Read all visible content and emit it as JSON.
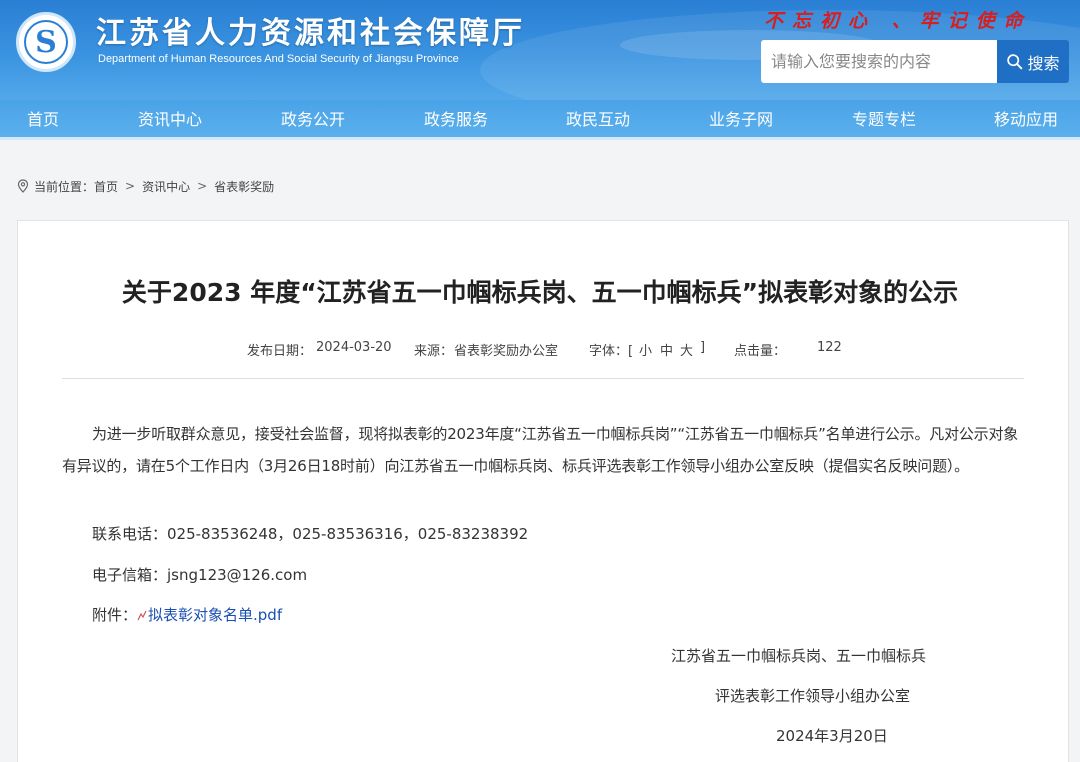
{
  "header": {
    "site_title": "江苏省人力资源和社会保障厅",
    "site_subtitle": "Department of Human Resources And Social Security of Jiangsu Province",
    "slogan": "不忘初心  、牢记使命",
    "search_placeholder": "请输入您要搜索的内容",
    "search_label": "搜索",
    "brand_color": "#2a7fd4",
    "slogan_color": "#d81e1e"
  },
  "nav": {
    "items": [
      "首页",
      "资讯中心",
      "政务公开",
      "政务服务",
      "政民互动",
      "业务子网",
      "专题专栏",
      "移动应用"
    ]
  },
  "breadcrumb": {
    "prefix": "当前位置：",
    "items": [
      "首页",
      "资讯中心",
      "省表彰奖励"
    ],
    "separator": ">"
  },
  "article": {
    "title": "关于2023 年度“江苏省五一巾帼标兵岗、五一巾帼标兵”拟表彰对象的公示",
    "publish_label": "发布日期：",
    "publish_date": "2024-03-20",
    "source_label": "来源：",
    "source": "省表彰奖励办公室",
    "font_label": "字体：[",
    "font_small": "小",
    "font_medium": "中",
    "font_large": "大",
    "font_close": "]",
    "views_label": "点击量：",
    "views": "122",
    "body": "为进一步听取群众意见，接受社会监督，现将拟表彰的2023年度“江苏省五一巾帼标兵岗”“江苏省五一巾帼标兵”名单进行公示。凡对公示对象有异议的，请在5个工作日内（3月26日18时前）向江苏省五一巾帼标兵岗、标兵评选表彰工作领导小组办公室反映（提倡实名反映问题）。",
    "phone_label": "联系电话：",
    "phones": "025-83536248，025-83536316，025-83238392",
    "email_label": "电子信箱：",
    "email": "jsng123@126.com",
    "attachment_label": "附件：",
    "attachment_name": "拟表彰对象名单.pdf",
    "signature_line1": "江苏省五一巾帼标兵岗、五一巾帼标兵",
    "signature_line2": "评选表彰工作领导小组办公室",
    "signature_date": "2024年3月20日"
  }
}
